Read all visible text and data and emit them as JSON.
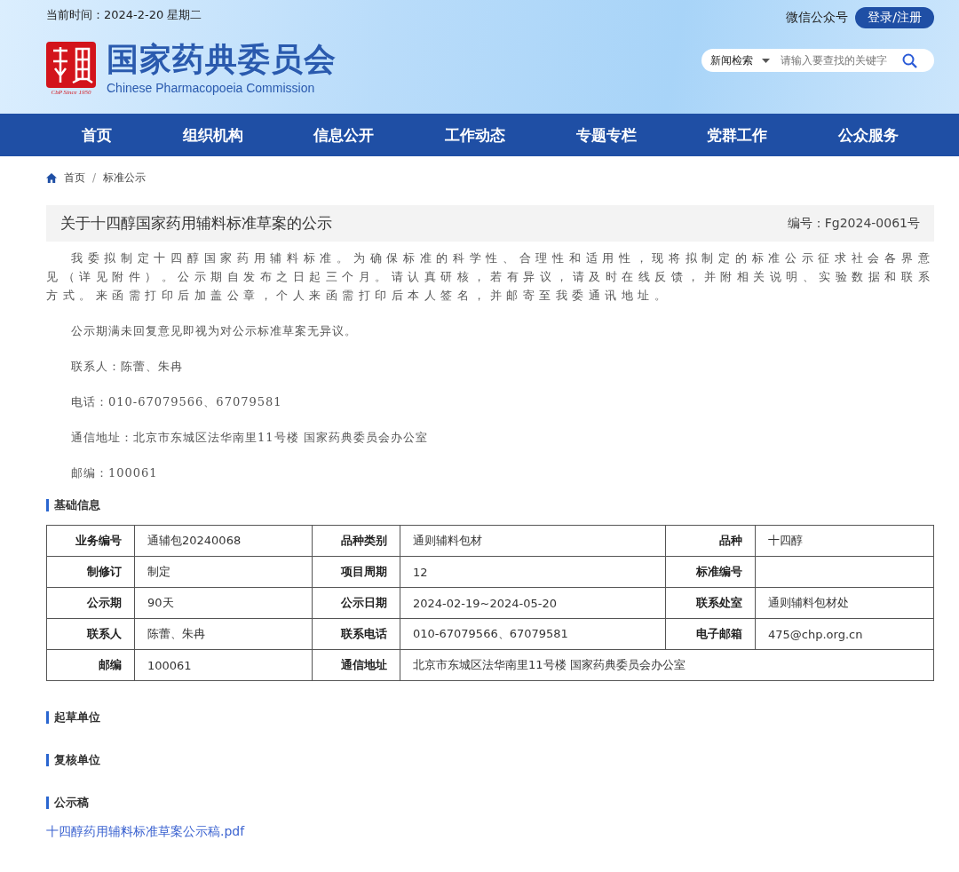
{
  "header": {
    "date": "当前时间：2024-2-20 星期二",
    "site_title": "国家药典委员会",
    "site_subtitle": "Chinese Pharmacopoeia Commission",
    "seal_caption": "CbP Since 1950",
    "wechat": "微信公众号",
    "login": "登录/注册",
    "search": {
      "category": "新闻检索",
      "placeholder": "请输入要查找的关键字"
    }
  },
  "nav": [
    {
      "label": "首页"
    },
    {
      "label": "组织机构"
    },
    {
      "label": "信息公开"
    },
    {
      "label": "工作动态"
    },
    {
      "label": "专题专栏"
    },
    {
      "label": "党群工作"
    },
    {
      "label": "公众服务"
    }
  ],
  "breadcrumb": [
    "首页",
    "标准公示"
  ],
  "breadcrumb_separator": "/",
  "notice": {
    "title": "关于十四醇国家药用辅料标准草案的公示",
    "number": "编号：Fg2024-0061号",
    "paragraphs": [
      "我委拟制定十四醇国家药用辅料标准。为确保标准的科学性、合理性和适用性，现将拟制定的标准公示征求社会各界意见（详见附件）。公示期自发布之日起三个月。请认真研核，若有异议，请及时在线反馈，并附相关说明、实验数据和联系方式。来函需打印后加盖公章，个人来函需打印后本人签名，并邮寄至我委通讯地址。",
      "公示期满未回复意见即视为对公示标准草案无异议。",
      "联系人：陈蕾、朱冉",
      "电话：010-67079566、67079581",
      "通信地址：北京市东城区法华南里11号楼 国家药典委员会办公室",
      "邮编：100061"
    ]
  },
  "sections": [
    {
      "heading": "基础信息",
      "table": [
        [
          {
            "label": "业务编号",
            "value": "通辅包20240068"
          },
          {
            "label": "品种类别",
            "value": "通则辅料包材"
          },
          {
            "label": "品种",
            "value": "十四醇"
          }
        ],
        [
          {
            "label": "制修订",
            "value": "制定"
          },
          {
            "label": "项目周期",
            "value": "12"
          },
          {
            "label": "标准编号"
          }
        ],
        [
          {
            "label": "公示期",
            "value": "90天"
          },
          {
            "label": "公示日期",
            "value": "2024-02-19~2024-05-20"
          },
          {
            "label": "联系处室",
            "value": "通则辅料包材处"
          }
        ],
        [
          {
            "label": "联系人",
            "value": "陈蕾、朱冉"
          },
          {
            "label": "联系电话",
            "value": "010-67079566、67079581"
          },
          {
            "label": "电子邮箱",
            "value": "475@chp.org.cn"
          }
        ],
        [
          {
            "label": "邮编",
            "value": "100061"
          },
          {
            "label": "通信地址",
            "value": "北京市东城区法华南里11号楼 国家药典委员会办公室"
          }
        ]
      ]
    },
    {
      "heading": "起草单位"
    },
    {
      "heading": "复核单位"
    },
    {
      "heading": "公示稿",
      "link": "十四醇药用辅料标准草案公示稿.pdf"
    }
  ]
}
